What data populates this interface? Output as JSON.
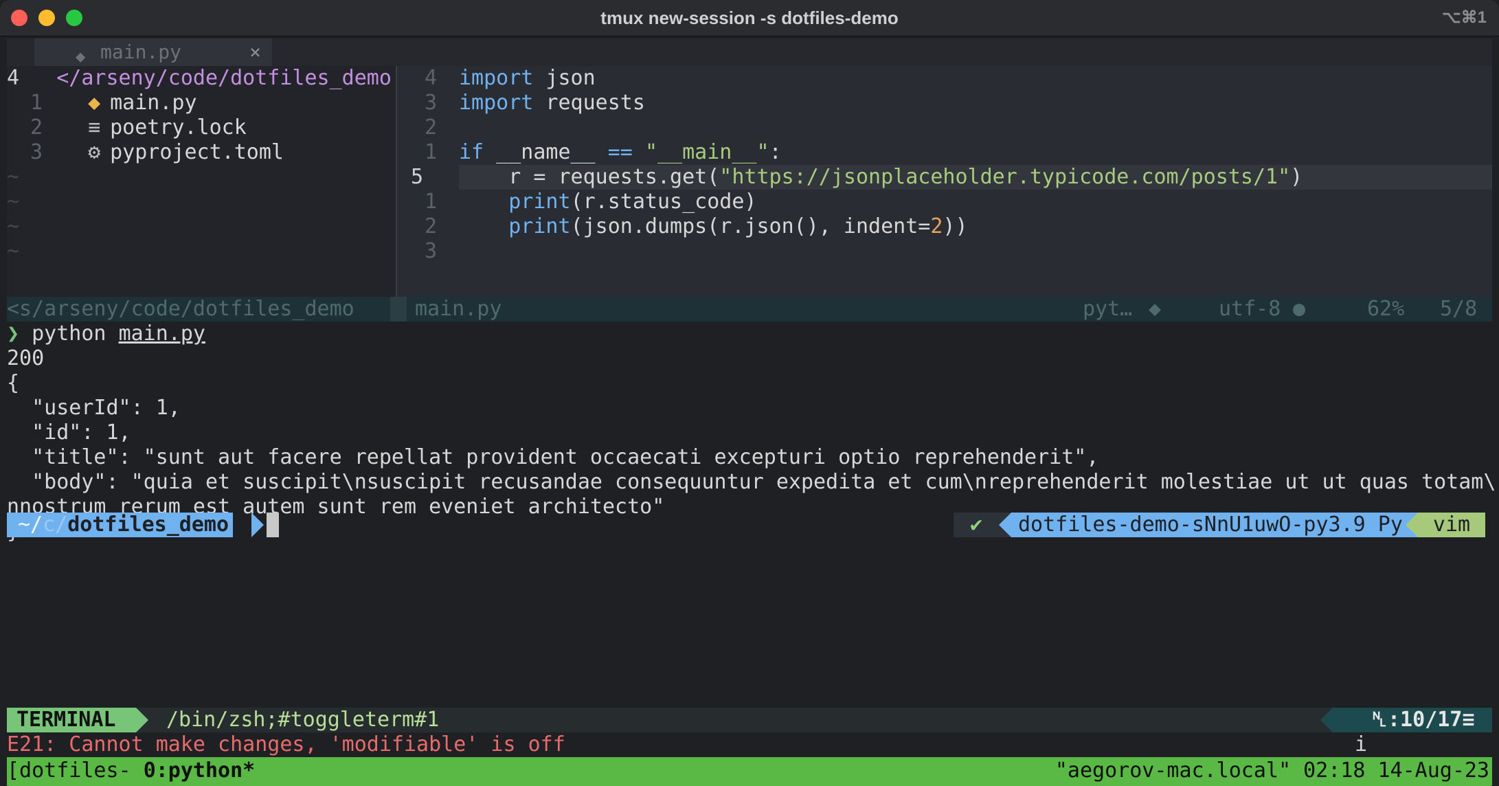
{
  "window": {
    "title": "tmux new-session -s dotfiles-demo",
    "shortcut": "⌥⌘1"
  },
  "tab": {
    "label": "main.py",
    "close": "×"
  },
  "tree": {
    "root_num": "4",
    "root": "</arseny/code/dotfiles_demo",
    "items": [
      {
        "num": "1",
        "icon": "python-file-icon",
        "name": "main.py"
      },
      {
        "num": "2",
        "icon": "lock-file-icon",
        "name": "poetry.lock"
      },
      {
        "num": "3",
        "icon": "gear-icon",
        "name": "pyproject.toml"
      }
    ]
  },
  "editor": {
    "lines": [
      {
        "num": "4",
        "parts": [
          [
            "kw",
            "import"
          ],
          [
            "",
            " json"
          ]
        ]
      },
      {
        "num": "3",
        "parts": [
          [
            "kw",
            "import"
          ],
          [
            "",
            " requests"
          ]
        ]
      },
      {
        "num": "2",
        "parts": []
      },
      {
        "num": "1",
        "parts": [
          [
            "kw",
            "if"
          ],
          [
            "",
            " __name__ "
          ],
          [
            "kw",
            "=="
          ],
          [
            "",
            " "
          ],
          [
            "str",
            "\"__main__\""
          ],
          [
            "",
            ":"
          ]
        ]
      },
      {
        "num": "5",
        "current": true,
        "parts": [
          [
            "",
            "    r = requests.get("
          ],
          [
            "str",
            "\"https://jsonplaceholder.typicode.com/posts/1\""
          ],
          [
            "",
            ")"
          ]
        ]
      },
      {
        "num": "1",
        "parts": [
          [
            "",
            "    "
          ],
          [
            "fn",
            "print"
          ],
          [
            "",
            "(r.status_code)"
          ]
        ]
      },
      {
        "num": "2",
        "parts": [
          [
            "",
            "    "
          ],
          [
            "fn",
            "print"
          ],
          [
            "",
            "(json.dumps(r.json(), indent="
          ],
          [
            "num",
            "2"
          ],
          [
            "",
            "))"
          ]
        ]
      },
      {
        "num": "3",
        "parts": []
      }
    ]
  },
  "statusline": {
    "left": "<s/arseny/code/dotfiles_demo",
    "file": "main.py",
    "filetype": "pyt…",
    "encoding": "utf-8",
    "percent": "62%",
    "position": "5/8"
  },
  "terminal": {
    "command_prefix": "❯",
    "command": "python",
    "command_arg": "main.py",
    "output": [
      "200",
      "{",
      "  \"userId\": 1,",
      "  \"id\": 1,",
      "  \"title\": \"sunt aut facere repellat provident occaecati excepturi optio reprehenderit\",",
      "  \"body\": \"quia et suscipit\\nsuscipit recusandae consequuntur expedita et cum\\nreprehenderit molestiae ut ut quas totam\\",
      "nnostrum rerum est autem sunt rem eveniet architecto\"",
      "}"
    ],
    "prompt_home": "~/",
    "prompt_mid": "c/",
    "prompt_dir": "dotfiles_demo",
    "check": "✔",
    "venv": "dotfiles-demo-sNnU1uwO-py3.9 Py",
    "vim": "vim"
  },
  "term_status": {
    "mode": "TERMINAL",
    "path": "/bin/zsh;#toggleterm#1",
    "position": "␤:10/17≡"
  },
  "message": {
    "text": "E21: Cannot make changes, 'modifiable' is off",
    "mode": "i"
  },
  "tmux": {
    "left_open": "[dotfiles- ",
    "window_index": "0",
    "window_name": ":python*",
    "right": "\"aegorov-mac.local\" 02:18 14-Aug-23"
  }
}
